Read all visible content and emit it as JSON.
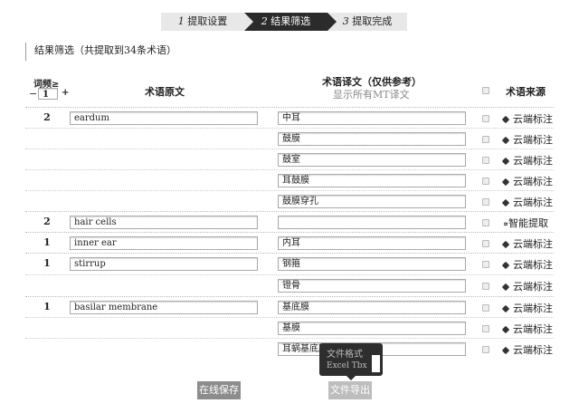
{
  "steps": [
    {
      "num": "1",
      "label": "提取设置"
    },
    {
      "num": "2",
      "label": "结果筛选"
    },
    {
      "num": "3",
      "label": "提取完成"
    }
  ],
  "title": "结果筛选（共提取到34条术语）",
  "header": {
    "freq_label": "词频≥",
    "freq_value": "1",
    "minus": "−",
    "plus": "+",
    "source_col": "术语原文",
    "target_col": "术语译文（仅供参考）",
    "show_mt": "显示所有MT译文",
    "origin_col": "术语来源"
  },
  "rows": [
    {
      "freq": "2",
      "source": "eardum",
      "target": "中耳",
      "origin": "云端标注"
    },
    {
      "target": "鼓膜",
      "origin": "云端标注"
    },
    {
      "target": "鼓室",
      "origin": "云端标注"
    },
    {
      "target": "耳鼓膜",
      "origin": "云端标注"
    },
    {
      "target": "鼓膜穿孔",
      "origin": "云端标注"
    },
    {
      "freq": "2",
      "source": "hair cells",
      "target": "",
      "origin": "智能提取"
    },
    {
      "freq": "1",
      "source": "inner ear",
      "target": "内耳",
      "origin": "云端标注"
    },
    {
      "freq": "1",
      "source": "stirrup",
      "target": "钢箍",
      "origin": "云端标注"
    },
    {
      "target": "镫骨",
      "origin": "云端标注"
    },
    {
      "freq": "1",
      "source": "basilar membrane",
      "target": "基底膜",
      "origin": "云端标注"
    },
    {
      "target": "基膜",
      "origin": "云端标注"
    },
    {
      "target": "耳蜗基底膜",
      "origin": "云端标注"
    }
  ],
  "tooltip": {
    "title": "文件格式",
    "option": "Excel Tbx"
  },
  "buttons": {
    "save": "在线保存",
    "export": "文件导出"
  }
}
